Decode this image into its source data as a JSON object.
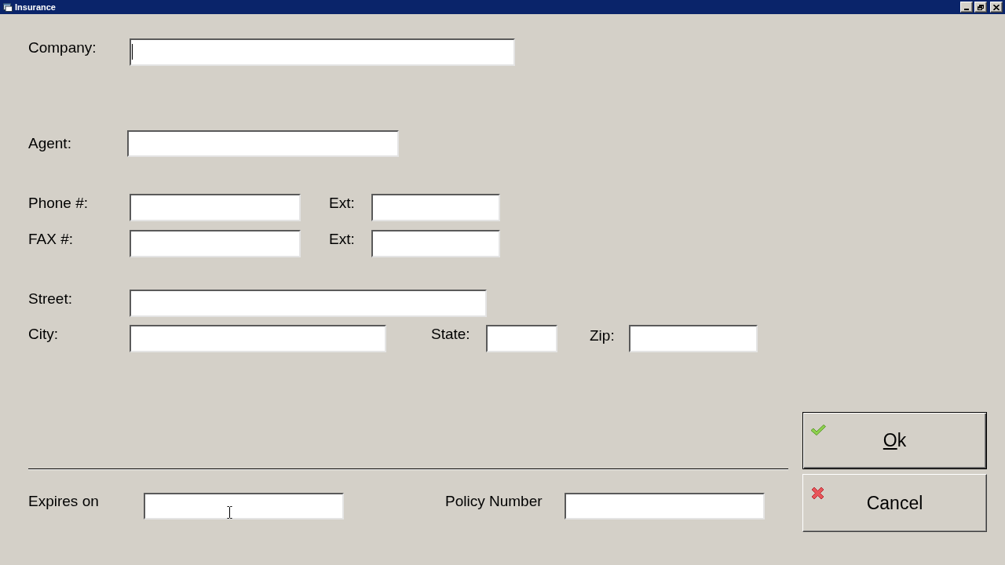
{
  "window": {
    "title": "Insurance"
  },
  "form": {
    "rows": [
      {
        "fields": [
          {
            "label": "Company:",
            "focused": true
          }
        ]
      },
      {
        "fields": [
          {
            "label": "Agent:",
            "focused": false
          }
        ]
      },
      {
        "fields": [
          {
            "label": "Phone #:",
            "focused": false
          },
          {
            "label": "Ext:",
            "focused": false
          }
        ]
      },
      {
        "fields": [
          {
            "label": "FAX #:",
            "focused": false
          },
          {
            "label": "Ext:",
            "focused": false
          }
        ]
      },
      {
        "fields": [
          {
            "label": "Street:",
            "focused": false
          }
        ]
      },
      {
        "fields": [
          {
            "label": "City:",
            "focused": false
          },
          {
            "label": "State:",
            "focused": false
          },
          {
            "label": "Zip:",
            "focused": false
          }
        ]
      }
    ]
  },
  "footer": {
    "fields": [
      {
        "label": "Expires on",
        "focused": false,
        "hovered": true
      },
      {
        "label": "Policy Number",
        "focused": false,
        "hovered": false
      }
    ]
  },
  "buttons": [
    {
      "label": "Ok",
      "kind": "ok",
      "default": true,
      "mnemonic": true
    },
    {
      "label": "Cancel",
      "kind": "cancel",
      "default": false,
      "mnemonic": false
    }
  ]
}
